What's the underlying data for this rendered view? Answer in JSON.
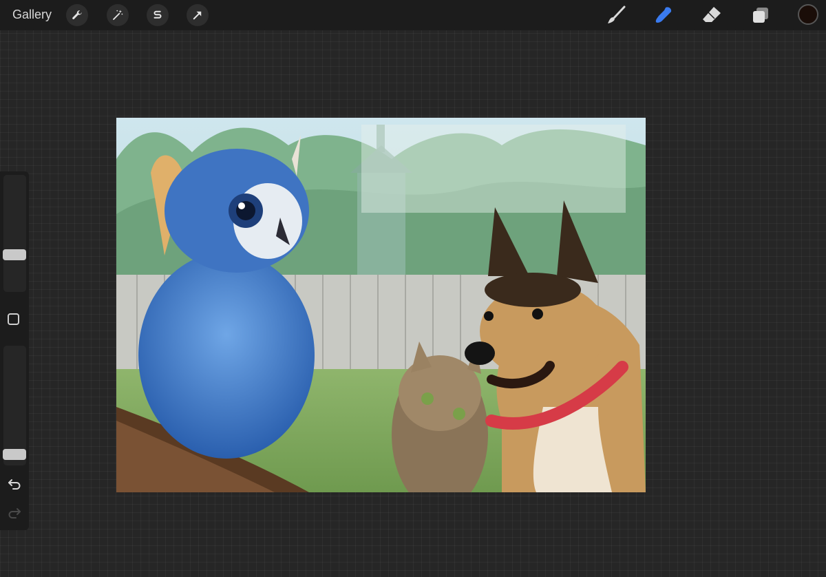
{
  "toolbar": {
    "gallery_label": "Gallery",
    "left_tools": [
      "wrench-icon",
      "magic-wand-icon",
      "selection-s-icon",
      "transform-arrow-icon"
    ],
    "right_tools": [
      "brush-icon",
      "smudge-icon",
      "eraser-icon",
      "layers-icon"
    ],
    "active_tool": "smudge-icon",
    "active_color": "#1a0d08",
    "accent_color": "#3a7bf0"
  },
  "sidebar": {
    "brush_size_level": 0.3,
    "opacity_level": 0.05,
    "icons": [
      "modify-square-icon",
      "undo-icon",
      "redo-icon"
    ]
  },
  "canvas": {
    "artwork": "owl-cat-dog-painting",
    "background_color": "#9bbf83"
  }
}
